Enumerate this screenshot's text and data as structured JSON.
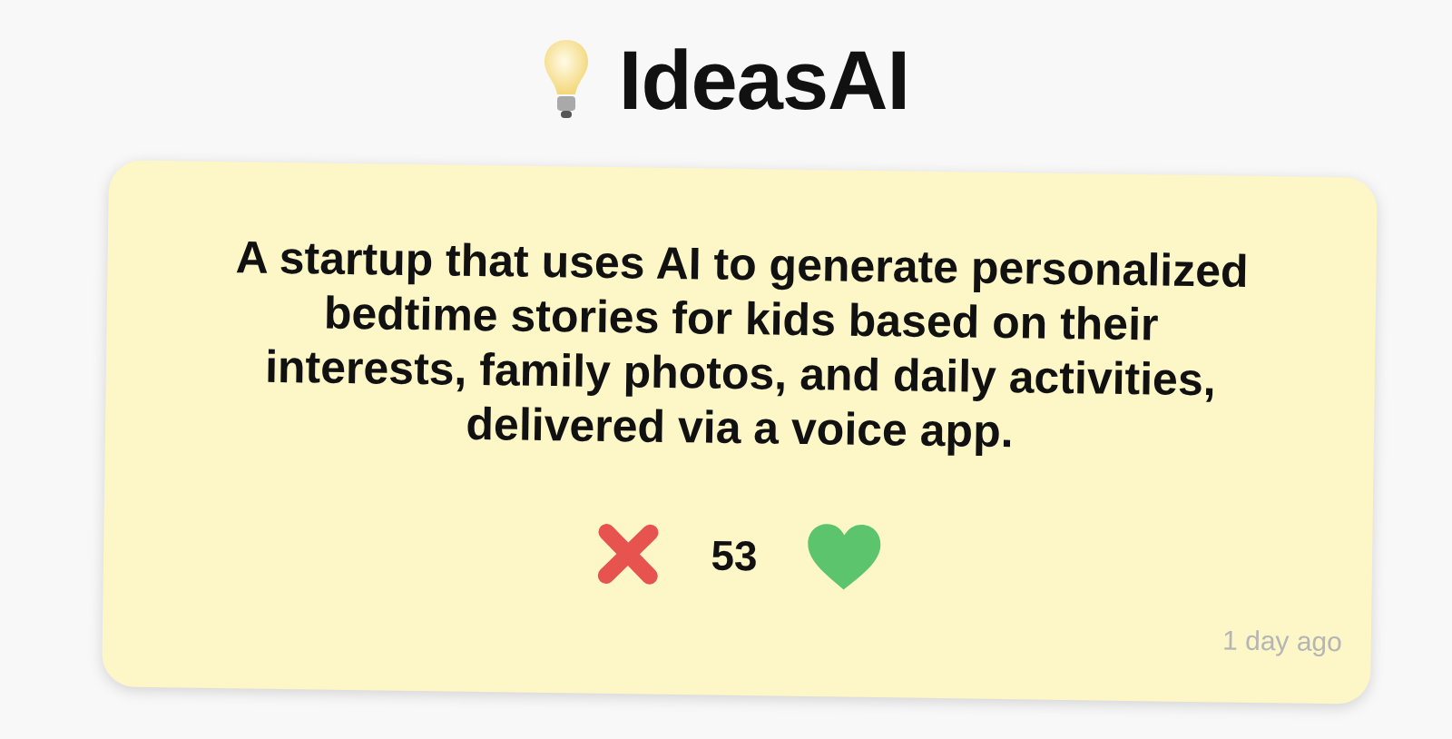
{
  "header": {
    "title": "IdeasAI"
  },
  "idea": {
    "text": "A startup that uses AI to generate personalized bedtime stories for kids based on their interests, family photos, and daily activities, delivered via a voice app.",
    "votes": "53",
    "time": "1 day ago"
  }
}
